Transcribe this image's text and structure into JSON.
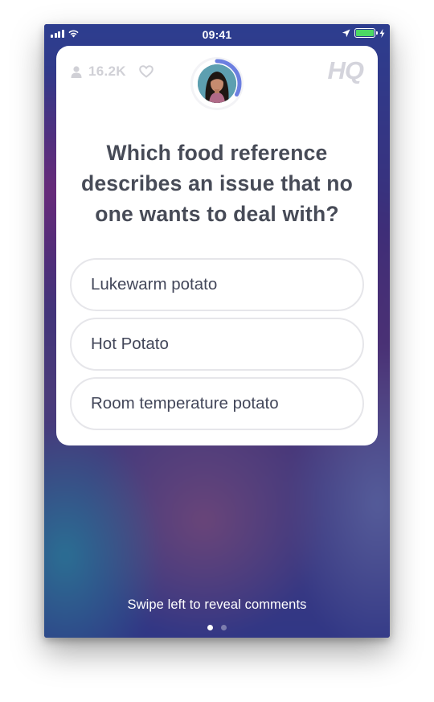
{
  "status_bar": {
    "time": "09:41",
    "battery_level": 1.0,
    "battery_color": "#4cd964",
    "icons": [
      "signal-bars-icon",
      "wifi-icon",
      "location-arrow-icon",
      "battery-icon",
      "charging-bolt-icon"
    ]
  },
  "card": {
    "viewer_count": "16.2K",
    "logo": "HQ",
    "icons": [
      "person-icon",
      "heart-icon"
    ],
    "timer_progress": 0.33,
    "timer_color": "#6c7fe0",
    "question": "Which food reference describes an issue that no one wants to deal with?",
    "answers": [
      "Lukewarm potato",
      "Hot Potato",
      "Room temperature potato"
    ]
  },
  "footer": {
    "swipe_hint": "Swipe left to reveal comments",
    "page_count": 2,
    "active_page": 1
  },
  "colors": {
    "card_text": "#474b57",
    "muted": "#d0d0d6",
    "answer_border": "#e6e6ea"
  }
}
